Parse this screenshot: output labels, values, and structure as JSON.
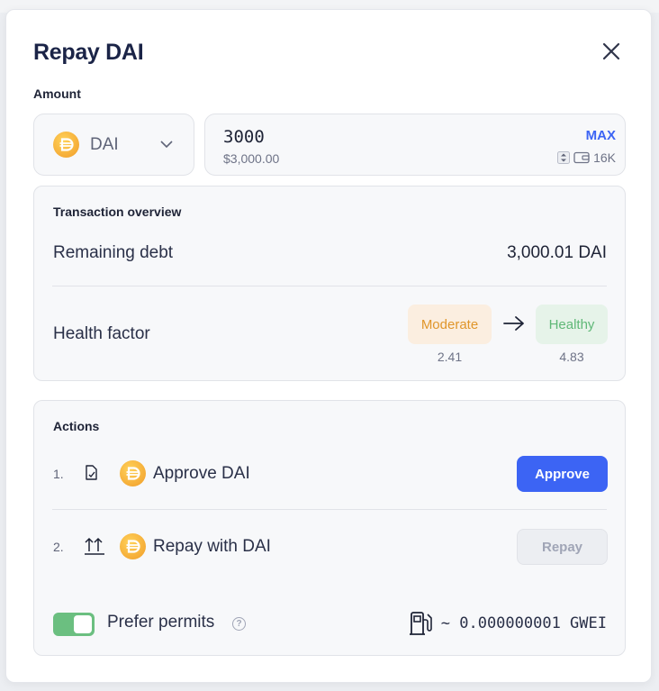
{
  "modal": {
    "title": "Repay DAI",
    "amount_label": "Amount"
  },
  "token": {
    "symbol": "DAI",
    "icon": "dai-coin-icon"
  },
  "amount": {
    "value": "3000",
    "usd": "$3,000.00",
    "max_label": "MAX",
    "balance": "16K"
  },
  "overview": {
    "title": "Transaction overview",
    "remaining_debt_label": "Remaining debt",
    "remaining_debt_value": "3,000.01 DAI",
    "health_factor_label": "Health factor",
    "hf_from_label": "Moderate",
    "hf_from_value": "2.41",
    "hf_to_label": "Healthy",
    "hf_to_value": "4.83"
  },
  "actions": {
    "title": "Actions",
    "steps": [
      {
        "num": "1.",
        "label": "Approve DAI",
        "button": "Approve",
        "icon": "sign-document-icon"
      },
      {
        "num": "2.",
        "label": "Repay with DAI",
        "button": "Repay",
        "icon": "repay-arrows-icon"
      }
    ],
    "prefer_permits_label": "Prefer permits",
    "prefer_permits_enabled": true,
    "gas_estimate": "~ 0.000000001 GWEI"
  },
  "colors": {
    "primary": "#3c64f4",
    "moderate": "#e0962b",
    "healthy": "#5fb877",
    "toggle_on": "#6bbf80"
  }
}
